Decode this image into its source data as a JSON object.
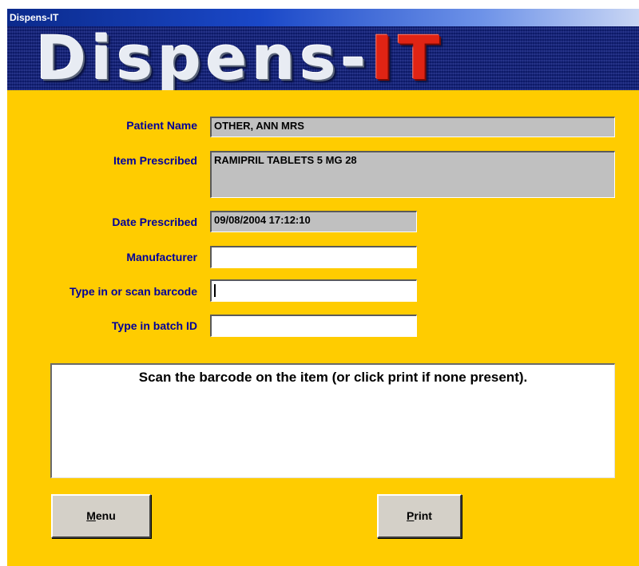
{
  "window": {
    "title": "Dispens-IT"
  },
  "banner": {
    "main": "Dispens-",
    "accent": "IT"
  },
  "form": {
    "patient_name": {
      "label": "Patient Name",
      "value": "OTHER, ANN MRS"
    },
    "item_prescribed": {
      "label": "Item Prescribed",
      "value": "RAMIPRIL  TABLETS 5 MG 28"
    },
    "date_prescribed": {
      "label": "Date Prescribed",
      "value": "09/08/2004 17:12:10"
    },
    "manufacturer": {
      "label": "Manufacturer",
      "value": ""
    },
    "barcode": {
      "label": "Type in or scan barcode",
      "value": ""
    },
    "batch_id": {
      "label": "Type in batch ID",
      "value": ""
    }
  },
  "message": {
    "text": "Scan the barcode on the item (or click print if none present)."
  },
  "buttons": {
    "menu": {
      "mnemonic": "M",
      "rest": "enu"
    },
    "print": {
      "mnemonic": "P",
      "rest": "rint"
    }
  },
  "colors": {
    "panel_bg": "#ffcc00",
    "label_text": "#00009a",
    "readonly_field": "#c0c0c0",
    "banner_bg": "#102080",
    "banner_accent": "#e02414"
  }
}
